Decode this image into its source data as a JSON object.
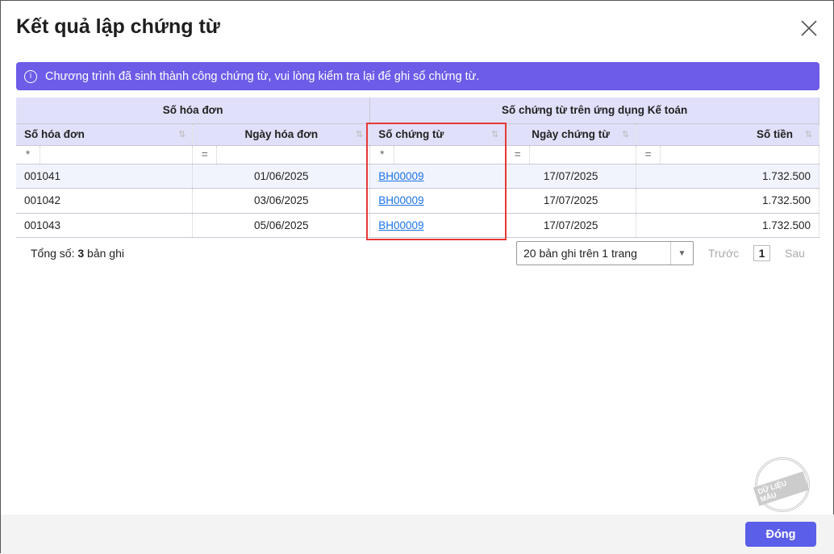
{
  "title": "Kết quả lập chứng từ",
  "banner": "Chương trình đã sinh thành công chứng từ, vui lòng kiểm tra lại để ghi sổ chứng từ.",
  "groups": [
    "Số hóa đơn",
    "Số chứng từ trên ứng dụng Kế toán"
  ],
  "columns": [
    "Số hóa đơn",
    "Ngày hóa đơn",
    "Số chứng từ",
    "Ngày chứng từ",
    "Số tiền"
  ],
  "filters": [
    "*",
    "=",
    "*",
    "=",
    "="
  ],
  "rows": [
    [
      "001041",
      "01/06/2025",
      "BH00009",
      "17/07/2025",
      "1.732.500"
    ],
    [
      "001042",
      "03/06/2025",
      "BH00009",
      "17/07/2025",
      "1.732.500"
    ],
    [
      "001043",
      "05/06/2025",
      "BH00009",
      "17/07/2025",
      "1.732.500"
    ]
  ],
  "footer": {
    "total_prefix": "Tổng số: ",
    "total_count": "3",
    "total_suffix": " bản ghi",
    "page_size": "20 bản ghi trên 1 trang",
    "prev": "Trước",
    "page": "1",
    "next": "Sau"
  },
  "stamp": "DỮ LIỆU MẪU",
  "close_button": "Đóng"
}
